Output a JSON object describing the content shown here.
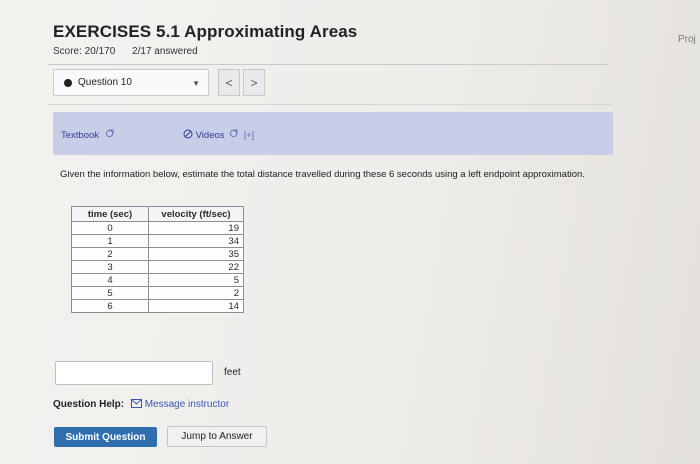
{
  "header": {
    "title": "EXERCISES 5.1 Approximating Areas",
    "score": "Score: 20/170",
    "answered": "2/17 answered",
    "right_cutoff": "Proj"
  },
  "question_nav": {
    "selected": "Question 10",
    "prev_label": "<",
    "next_label": ">"
  },
  "help_links": {
    "textbook": "Textbook",
    "videos": "Videos",
    "videos_count": "[+]"
  },
  "problem": {
    "text": "Given the information below, estimate the total distance travelled during these 6 seconds using a left endpoint approximation."
  },
  "table": {
    "headers": [
      "time (sec)",
      "velocity (ft/sec)"
    ],
    "rows": [
      [
        "0",
        "19"
      ],
      [
        "1",
        "34"
      ],
      [
        "2",
        "35"
      ],
      [
        "3",
        "22"
      ],
      [
        "4",
        "5"
      ],
      [
        "5",
        "2"
      ],
      [
        "6",
        "14"
      ]
    ]
  },
  "answer": {
    "value": "",
    "unit": "feet"
  },
  "help": {
    "label": "Question Help:",
    "message": "Message instructor"
  },
  "buttons": {
    "submit": "Submit Question",
    "jump": "Jump to Answer"
  }
}
